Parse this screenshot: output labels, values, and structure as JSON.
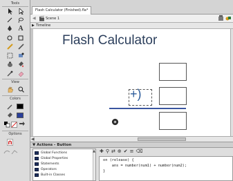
{
  "tools_panel": {
    "title": "Tools",
    "view_label": "View",
    "colors_label": "Colors",
    "options_label": "Options"
  },
  "document": {
    "tab_label": "Flash Calculator (Finished).fla*",
    "scene_label": "Scene 1",
    "timeline_label": "Timeline"
  },
  "stage": {
    "title": "Flash Calculator",
    "operator": "+)"
  },
  "actions_panel": {
    "header": "▼ Actions - Button",
    "categories": [
      "Global Functions",
      "Global Properties",
      "Statements",
      "Operators",
      "Built-in Classes"
    ],
    "code_lines": [
      "on (release) {",
      "    ans = number(num1) + number(num2);",
      "}"
    ]
  },
  "colors": {
    "title_text": "#2c3f5c",
    "operator_text": "#2a5a9a",
    "rule": "#3a55a0"
  }
}
